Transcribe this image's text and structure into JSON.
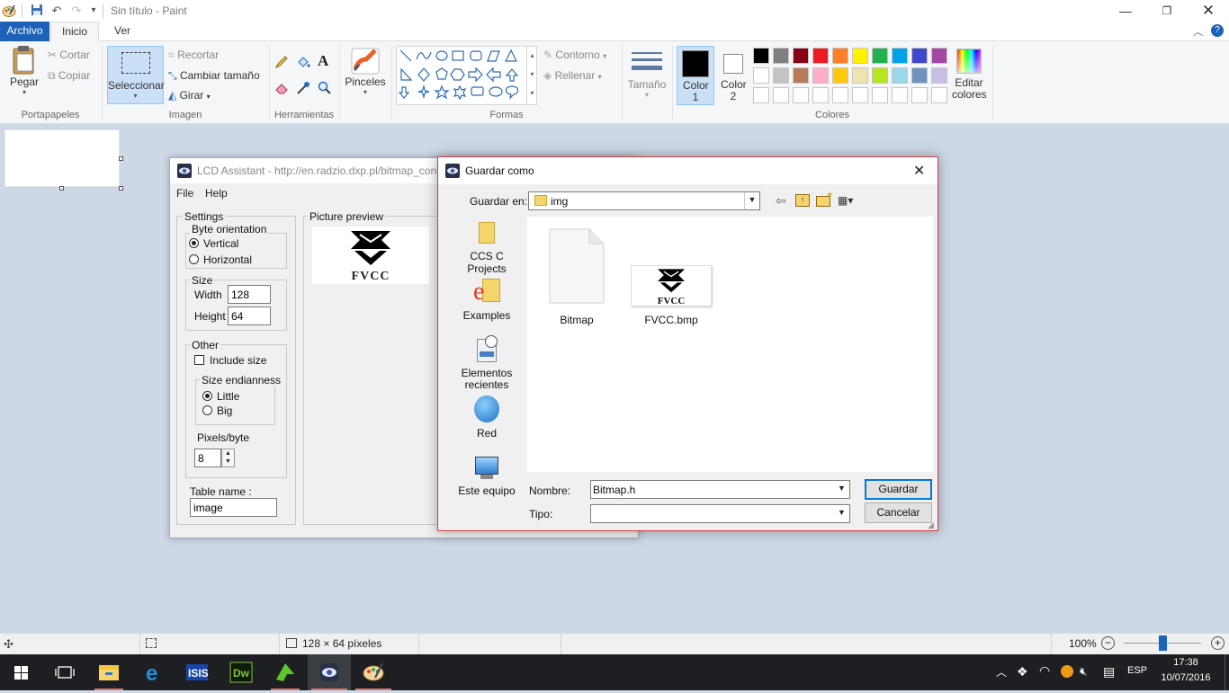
{
  "paint": {
    "title": "Sin título - Paint",
    "tabs": {
      "file": "Archivo",
      "home": "Inicio",
      "view": "Ver"
    },
    "clipboard": {
      "paste": "Pegar",
      "cut": "Cortar",
      "copy": "Copiar",
      "group": "Portapapeles"
    },
    "image": {
      "select": "Seleccionar",
      "crop": "Recortar",
      "resize": "Cambiar tamaño",
      "rotate": "Girar",
      "group": "Imagen"
    },
    "tools": {
      "group": "Herramientas"
    },
    "brushes": {
      "label": "Pinceles"
    },
    "shapes": {
      "outline": "Contorno",
      "fill": "Rellenar",
      "group": "Formas"
    },
    "size": {
      "label": "Tamaño"
    },
    "colors": {
      "color1": "Color 1",
      "color2": "Color 2",
      "edit": "Editar colores",
      "group": "Colores",
      "row1": [
        "#000000",
        "#7f7f7f",
        "#880015",
        "#ed1c24",
        "#ff7f27",
        "#fff200",
        "#22b14c",
        "#00a2e8",
        "#3f48cc",
        "#a349a4"
      ],
      "row2": [
        "#ffffff",
        "#c3c3c3",
        "#b97a57",
        "#ffaec9",
        "#ffc90e",
        "#efe4b0",
        "#b5e61d",
        "#99d9ea",
        "#7092be",
        "#c8bfe7"
      ]
    },
    "status": {
      "size": "128 × 64 píxeles",
      "zoom": "100%"
    }
  },
  "lcd": {
    "title": "LCD Assistant -  http://en.radzio.dxp.pl/bitmap_con",
    "menu": {
      "file": "File",
      "help": "Help"
    },
    "settings": {
      "legend": "Settings",
      "orientation": {
        "legend": "Byte orientation",
        "vertical": "Vertical",
        "horizontal": "Horizontal"
      },
      "size": {
        "legend": "Size",
        "width_label": "Width",
        "width": "128",
        "height_label": "Height",
        "height": "64"
      },
      "other": {
        "legend": "Other",
        "include_size": "Include size",
        "endian": {
          "legend": "Size endianness",
          "little": "Little",
          "big": "Big"
        },
        "ppb_label": "Pixels/byte",
        "ppb": "8"
      },
      "table_label": "Table name :",
      "table_name": "image"
    },
    "preview": {
      "legend": "Picture preview",
      "logo_text": "FVCC"
    }
  },
  "dialog": {
    "title": "Guardar como",
    "save_in_label": "Guardar en:",
    "save_in": "img",
    "places": [
      "CCS C Projects",
      "Examples",
      "Elementos recientes",
      "Red",
      "Este equipo"
    ],
    "files": [
      {
        "name": "Bitmap"
      },
      {
        "name": "FVCC.bmp",
        "logo_text": "FVCC"
      }
    ],
    "name_label": "Nombre:",
    "name_value": "Bitmap.h",
    "type_label": "Tipo:",
    "type_value": "",
    "save_button": "Guardar",
    "cancel_button": "Cancelar"
  },
  "taskbar": {
    "lang": "ESP",
    "time": "17:38",
    "date": "10/07/2016"
  }
}
